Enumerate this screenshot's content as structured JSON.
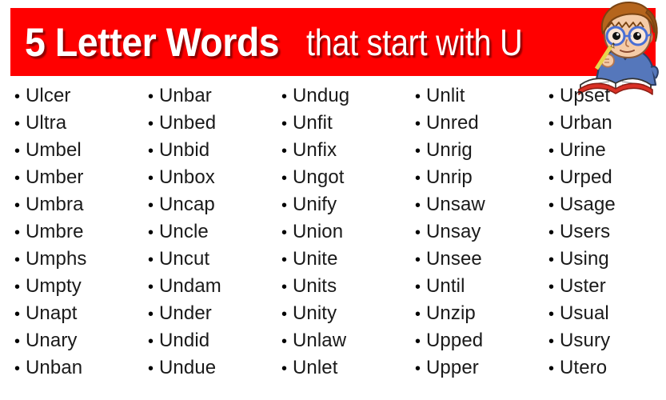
{
  "header": {
    "title_bold": "5 Letter Words",
    "title_light": "that start with U",
    "background_color": "#ff0000",
    "text_color": "#ffffff"
  },
  "mascot": {
    "name": "studying-boy-illustration",
    "hair_color": "#b5651d",
    "skin_color": "#f5cba7",
    "glasses_color": "#4a6fd4",
    "shirt_color": "#5577bb",
    "pencil_color": "#e8d44d",
    "book_color": "#d93025"
  },
  "bullet_glyph": "•",
  "columns": [
    {
      "name": "column-1",
      "words": [
        "Ulcer",
        "Ultra",
        "Umbel",
        "Umber",
        "Umbra",
        "Umbre",
        "Umphs",
        "Umpty",
        "Unapt",
        "Unary",
        "Unban"
      ]
    },
    {
      "name": "column-2",
      "words": [
        "Unbar",
        "Unbed",
        "Unbid",
        "Unbox",
        "Uncap",
        "Uncle",
        "Uncut",
        "Undam",
        "Under",
        "Undid",
        "Undue"
      ]
    },
    {
      "name": "column-3",
      "words": [
        "Undug",
        "Unfit",
        "Unfix",
        "Ungot",
        "Unify",
        "Union",
        "Unite",
        "Units",
        "Unity",
        "Unlaw",
        "Unlet"
      ]
    },
    {
      "name": "column-4",
      "words": [
        "Unlit",
        "Unred",
        "Unrig",
        "Unrip",
        "Unsaw",
        "Unsay",
        "Unsee",
        "Until",
        "Unzip",
        "Upped",
        "Upper"
      ]
    },
    {
      "name": "column-5",
      "words": [
        "Upset",
        "Urban",
        "Urine",
        "Urped",
        "Usage",
        "Users",
        "Using",
        "Uster",
        "Usual",
        "Usury",
        "Utero"
      ]
    }
  ]
}
